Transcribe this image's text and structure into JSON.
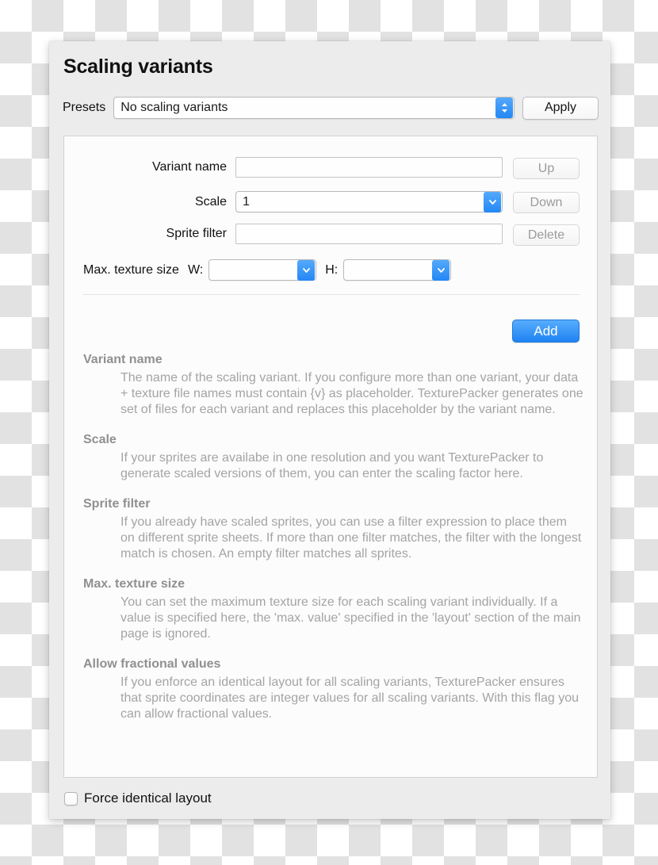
{
  "window": {
    "title": "Scaling variants"
  },
  "presets": {
    "label": "Presets",
    "selected": "No scaling variants",
    "apply_label": "Apply",
    "dropdown_icon": "chevron-up-down-icon"
  },
  "form": {
    "variant_name": {
      "label": "Variant name",
      "value": "",
      "placeholder": ""
    },
    "scale": {
      "label": "Scale",
      "value": "1",
      "dropdown_icon": "chevron-down-icon"
    },
    "sprite_filter": {
      "label": "Sprite filter",
      "value": "",
      "placeholder": ""
    },
    "max_texture_size": {
      "label": "Max. texture size",
      "width_label": "W:",
      "width_value": "",
      "height_label": "H:",
      "height_value": "",
      "dropdown_icon": "chevron-down-icon"
    }
  },
  "side_buttons": [
    {
      "label": "Up",
      "name": "up-button",
      "enabled": false
    },
    {
      "label": "Down",
      "name": "down-button",
      "enabled": false
    },
    {
      "label": "Delete",
      "name": "delete-button",
      "enabled": false
    }
  ],
  "add_button": {
    "label": "Add"
  },
  "help": [
    {
      "title": "Variant name",
      "body": "The name of the scaling variant. If you configure more than one variant, your data + texture file names must contain {v} as placeholder. TexturePacker generates one set of files for each variant and replaces this placeholder by the variant name."
    },
    {
      "title": "Scale",
      "body": "If your sprites are availabe in one resolution and you want TexturePacker to generate scaled versions of them, you can enter the scaling factor here."
    },
    {
      "title": "Sprite filter",
      "body": "If you already have scaled sprites, you can use a filter expression to place them on different sprite sheets. If more than one filter matches, the filter with the longest match is chosen. An empty filter matches all sprites."
    },
    {
      "title": "Max. texture size",
      "body": "You can set the maximum texture size for each scaling variant individually. If a value is specified here, the 'max. value' specified in the 'layout' section of the main page is ignored."
    },
    {
      "title": "Allow fractional values",
      "body": "If you enforce an identical layout for all scaling variants, TexturePacker ensures that sprite coordinates are integer values for all scaling variants. With this flag you can allow fractional values."
    }
  ],
  "footer": {
    "force_identical_layout_label": "Force identical layout",
    "force_identical_layout_checked": false
  },
  "colors": {
    "accent_blue": "#2487f5",
    "panel_background": "#ececec",
    "content_background": "#fcfcfc",
    "help_text": "#a4a4a4",
    "help_title": "#909090",
    "disabled_text": "#9b9b9b"
  }
}
